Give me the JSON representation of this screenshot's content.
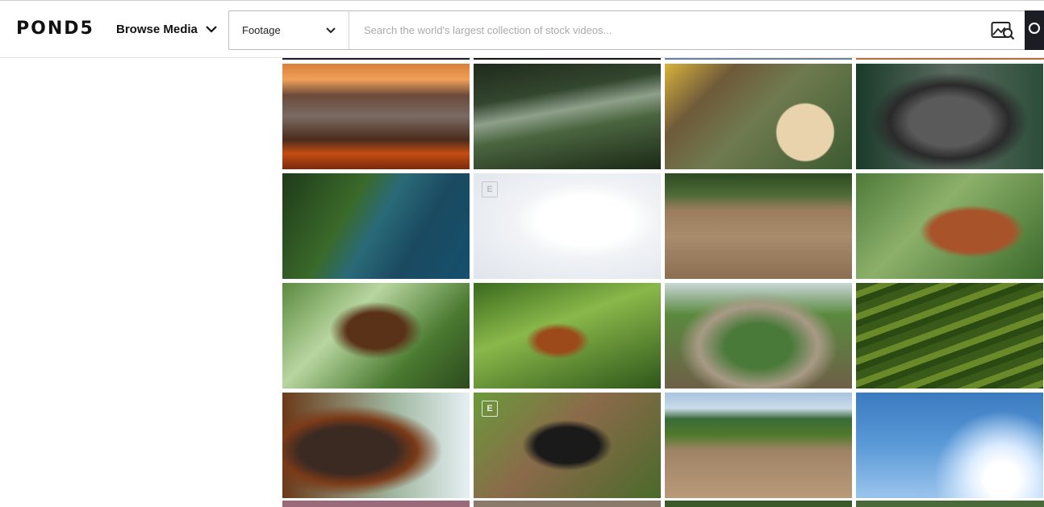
{
  "header": {
    "logo": "POND5",
    "browse_label": "Browse Media",
    "media_type": "Footage",
    "search_placeholder": "Search the world's largest collection of stock videos..."
  },
  "tiles": [
    {
      "name": "volcano-sunrise-thumb",
      "badge": ""
    },
    {
      "name": "jungle-palms-thumb",
      "badge": ""
    },
    {
      "name": "log-loader-thumb",
      "badge": ""
    },
    {
      "name": "gorilla-thumb",
      "badge": ""
    },
    {
      "name": "coastal-cliff-aerial-thumb",
      "badge": ""
    },
    {
      "name": "polar-bear-thumb",
      "badge": "E"
    },
    {
      "name": "cleared-land-aerial-thumb",
      "badge": ""
    },
    {
      "name": "orangutan-tree-thumb",
      "badge": ""
    },
    {
      "name": "orangutan-swinging-thumb",
      "badge": ""
    },
    {
      "name": "orangutan-hanging-thumb",
      "badge": ""
    },
    {
      "name": "waterfall-360-thumb",
      "badge": ""
    },
    {
      "name": "rice-terraces-thumb",
      "badge": ""
    },
    {
      "name": "orangutan-portrait-thumb",
      "badge": ""
    },
    {
      "name": "chimpanzee-branch-thumb",
      "badge": "E"
    },
    {
      "name": "deforested-field-thumb",
      "badge": ""
    },
    {
      "name": "seagulls-sky-thumb",
      "badge": ""
    }
  ],
  "colors": {
    "search_button": "#1c1c24",
    "border": "#bdbdbd"
  }
}
